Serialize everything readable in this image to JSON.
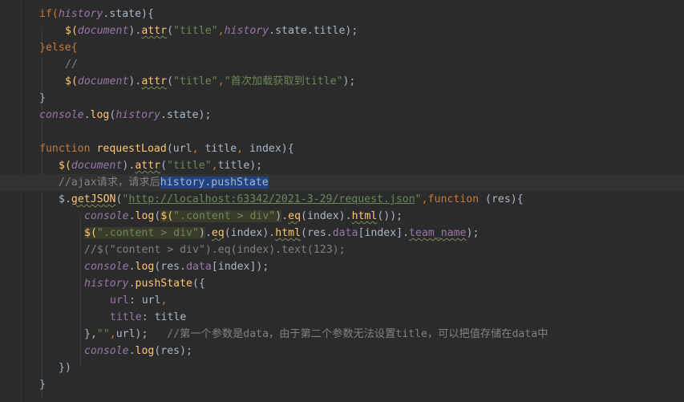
{
  "editor": {
    "lines": [
      {
        "indent": 49,
        "tokens": [
          [
            "if(",
            "k"
          ],
          [
            "history",
            "g"
          ],
          [
            ".state){",
            "p"
          ]
        ]
      },
      {
        "indent": 81,
        "tokens": [
          [
            "$(",
            "f"
          ],
          [
            "document",
            "g"
          ],
          [
            ").",
            "p"
          ],
          [
            "attr",
            "f sq"
          ],
          [
            "(",
            "p"
          ],
          [
            "\"title\"",
            "s"
          ],
          [
            ",",
            "k"
          ],
          [
            "history",
            "g"
          ],
          [
            ".state.title);",
            "p"
          ]
        ]
      },
      {
        "indent": 49,
        "tokens": [
          [
            "}else{",
            "k"
          ]
        ]
      },
      {
        "indent": 81,
        "tokens": [
          [
            "//",
            "c"
          ]
        ]
      },
      {
        "indent": 81,
        "tokens": [
          [
            "$(",
            "f"
          ],
          [
            "document",
            "g"
          ],
          [
            ").",
            "p"
          ],
          [
            "attr",
            "f sq"
          ],
          [
            "(",
            "p"
          ],
          [
            "\"title\"",
            "s"
          ],
          [
            ",",
            "k"
          ],
          [
            "\"首次加载获取到title\"",
            "s"
          ],
          [
            ");",
            "p"
          ]
        ]
      },
      {
        "indent": 49,
        "tokens": [
          [
            "}",
            "p"
          ]
        ]
      },
      {
        "indent": 49,
        "tokens": [
          [
            "console",
            "g"
          ],
          [
            ".",
            "p"
          ],
          [
            "log",
            "f"
          ],
          [
            "(",
            "p"
          ],
          [
            "history",
            "g"
          ],
          [
            ".state);",
            "p"
          ]
        ]
      },
      {
        "indent": 49,
        "tokens": []
      },
      {
        "indent": 49,
        "tokens": [
          [
            "function ",
            "k"
          ],
          [
            "requestLoad",
            "f"
          ],
          [
            "(url",
            ""
          ],
          [
            ", ",
            "k"
          ],
          [
            "title",
            ""
          ],
          [
            ", ",
            "k"
          ],
          [
            "index){",
            "p"
          ]
        ]
      },
      {
        "indent": 73,
        "tokens": [
          [
            "$(",
            "f"
          ],
          [
            "document",
            "g"
          ],
          [
            ").",
            "p"
          ],
          [
            "attr",
            "f sq"
          ],
          [
            "(",
            "p"
          ],
          [
            "\"title\"",
            "s"
          ],
          [
            ",",
            "k"
          ],
          [
            "title);",
            "p"
          ]
        ]
      },
      {
        "indent": 73,
        "current": true,
        "tokens": [
          [
            "//ajax请求，请求后",
            "c"
          ],
          [
            "history.pushState",
            "c sel"
          ]
        ]
      },
      {
        "indent": 73,
        "tokens": [
          [
            "$.",
            "p"
          ],
          [
            "getJSON",
            "f sq"
          ],
          [
            "(",
            "p"
          ],
          [
            "\"",
            "s"
          ],
          [
            "http://localhost:63342/2021-3-29/request.json",
            "s u"
          ],
          [
            "\"",
            "s"
          ],
          [
            ",",
            "k"
          ],
          [
            "function ",
            "k"
          ],
          [
            "(res){",
            "p"
          ]
        ]
      },
      {
        "indent": 105,
        "tokens": [
          [
            "console",
            "g"
          ],
          [
            ".",
            "p"
          ],
          [
            "log",
            "f"
          ],
          [
            "(",
            "p"
          ],
          [
            "$(",
            "f jqhl"
          ],
          [
            "\".content > div\"",
            "s jqhl"
          ],
          [
            ")",
            "p jqhl"
          ],
          [
            ".",
            "p"
          ],
          [
            "eq",
            "f sq"
          ],
          [
            "(index).",
            "p"
          ],
          [
            "html",
            "f sq"
          ],
          [
            "());",
            "p"
          ]
        ]
      },
      {
        "indent": 105,
        "tokens": [
          [
            "$(",
            "f jqhl"
          ],
          [
            "\".content > div\"",
            "s jqhl"
          ],
          [
            ")",
            "p jqhl"
          ],
          [
            ".",
            "p"
          ],
          [
            "eq",
            "f sq"
          ],
          [
            "(index).",
            "p"
          ],
          [
            "html",
            "f sq"
          ],
          [
            "(res.",
            "p"
          ],
          [
            "data",
            "m"
          ],
          [
            "[index].",
            "p"
          ],
          [
            "team_name",
            "m sq"
          ],
          [
            ");",
            "p"
          ]
        ]
      },
      {
        "indent": 105,
        "tokens": [
          [
            "//$(\"content > div\").eq(index).text(123);",
            "c"
          ]
        ]
      },
      {
        "indent": 105,
        "tokens": [
          [
            "console",
            "g"
          ],
          [
            ".",
            "p"
          ],
          [
            "log",
            "f"
          ],
          [
            "(res.",
            "p"
          ],
          [
            "data",
            "m"
          ],
          [
            "[index]);",
            "p"
          ]
        ]
      },
      {
        "indent": 105,
        "tokens": [
          [
            "history",
            "g"
          ],
          [
            ".",
            "p"
          ],
          [
            "pushState",
            "f"
          ],
          [
            "({",
            "p"
          ]
        ]
      },
      {
        "indent": 137,
        "tokens": [
          [
            "url",
            "m"
          ],
          [
            ": url",
            ""
          ],
          [
            ",",
            "k"
          ]
        ]
      },
      {
        "indent": 137,
        "tokens": [
          [
            "title",
            "m"
          ],
          [
            ": title",
            ""
          ]
        ]
      },
      {
        "indent": 105,
        "tokens": [
          [
            "},",
            "p"
          ],
          [
            "\"\"",
            "s"
          ],
          [
            ",",
            "k"
          ],
          [
            "url);",
            "p"
          ],
          [
            "   //第一个参数是data，由于第二个参数无法设置title，可以把值存储在data中",
            "c"
          ]
        ]
      },
      {
        "indent": 105,
        "tokens": [
          [
            "console",
            "g"
          ],
          [
            ".",
            "p"
          ],
          [
            "log",
            "f"
          ],
          [
            "(res);",
            "p"
          ]
        ]
      },
      {
        "indent": 73,
        "tokens": [
          [
            "})",
            "p"
          ]
        ]
      },
      {
        "indent": 49,
        "tokens": [
          [
            "}",
            "p"
          ]
        ]
      }
    ]
  }
}
